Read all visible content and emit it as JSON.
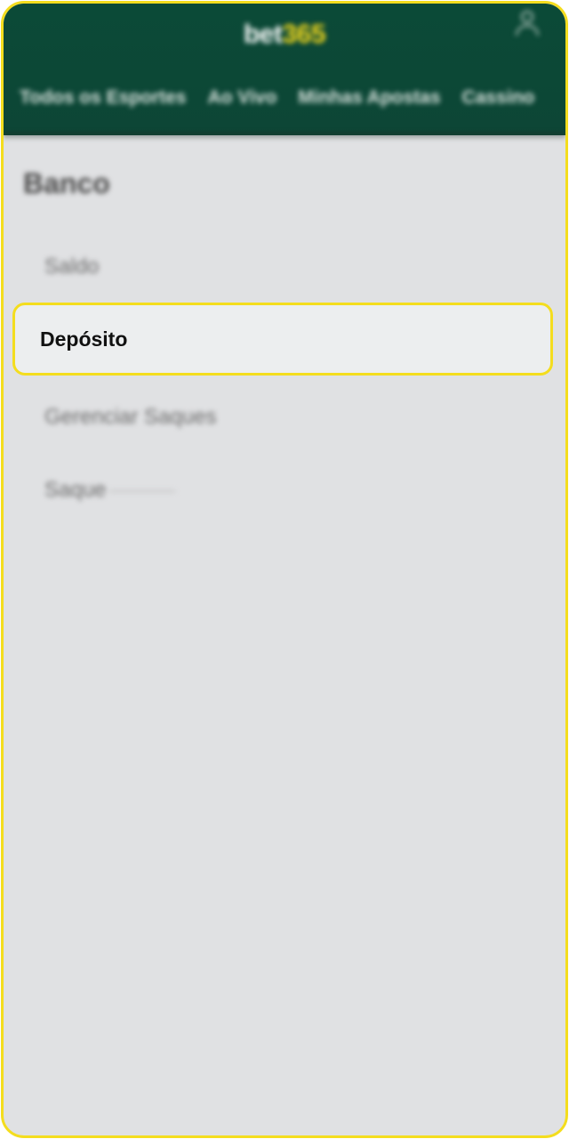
{
  "header": {
    "logo_part1": "bet",
    "logo_part2": "365",
    "account_icon": "user-icon",
    "nav": [
      {
        "label": "Todos os Esportes"
      },
      {
        "label": "Ao Vivo"
      },
      {
        "label": "Minhas Apostas"
      },
      {
        "label": "Cassino"
      }
    ]
  },
  "bank": {
    "title": "Banco",
    "items": [
      {
        "label": "Saldo"
      },
      {
        "label": "Depósito"
      },
      {
        "label": "Gerenciar Saques"
      },
      {
        "label": "Saque"
      }
    ]
  },
  "colors": {
    "header_bg": "#0b4a37",
    "accent_yellow": "#f4dd1e",
    "page_bg": "#e0e1e3"
  }
}
